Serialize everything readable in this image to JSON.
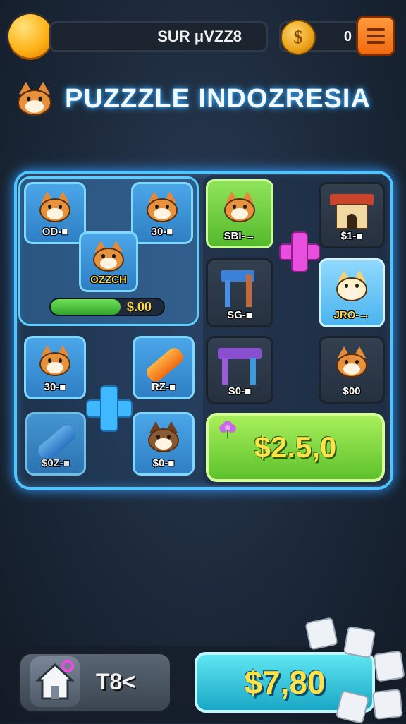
{
  "top_bar": {
    "player_name": "SUR μVZZ8",
    "coins": "0",
    "coin_symbol": "$"
  },
  "title": "PUZZZLE INDOZRESIA",
  "board": {
    "left_tiles": [
      {
        "id": "t1",
        "label": "OD-■"
      },
      {
        "id": "t2",
        "label": "30-■"
      },
      {
        "id": "t3",
        "label": "OZZCH"
      },
      {
        "id": "t4",
        "label": "30-■"
      },
      {
        "id": "t5",
        "label": "RZ-■"
      },
      {
        "id": "t6",
        "label": "$0Z-■"
      },
      {
        "id": "t7",
        "label": "$0-■"
      }
    ],
    "progress": {
      "value_label": "$.00",
      "fill_fraction": 0.62
    },
    "right_tiles": [
      {
        "id": "r1",
        "label": "SBI-→"
      },
      {
        "id": "r2",
        "label": "$1-■"
      },
      {
        "id": "r3",
        "label": "SG-■"
      },
      {
        "id": "r4",
        "label": "JRO-→"
      },
      {
        "id": "r5",
        "label": "S0-■"
      },
      {
        "id": "r6",
        "label": "$00"
      }
    ],
    "big_price": "$2.5,0"
  },
  "bottom": {
    "home_label": "T8<",
    "buy_price": "$7,80"
  },
  "colors": {
    "accent_glow": "#4fc4ff",
    "price_yellow": "#ffe14a",
    "green": "#5dc22c"
  }
}
